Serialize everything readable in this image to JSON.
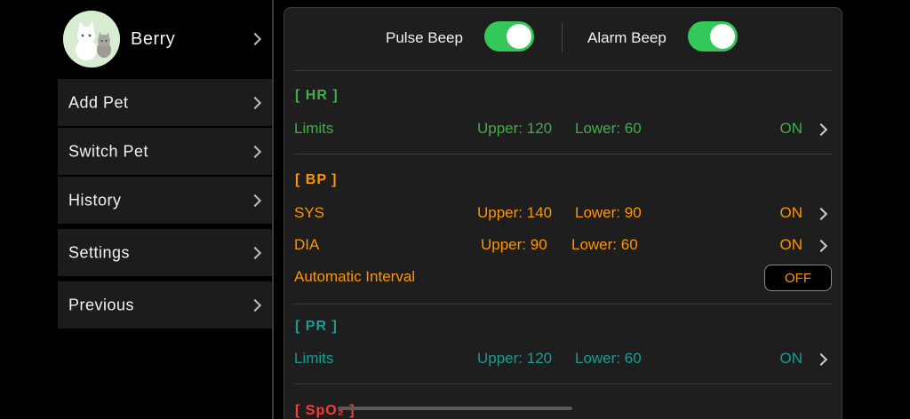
{
  "profile": {
    "name": "Berry"
  },
  "menu": {
    "add_pet": "Add Pet",
    "switch_pet": "Switch Pet",
    "history": "History",
    "settings": "Settings",
    "previous": "Previous"
  },
  "toggles": {
    "pulse_beep": {
      "label": "Pulse Beep",
      "on": true
    },
    "alarm_beep": {
      "label": "Alarm Beep",
      "on": true
    }
  },
  "hr": {
    "title": "[ HR ]",
    "limits": {
      "name": "Limits",
      "upper": "Upper: 120",
      "lower": "Lower: 60",
      "state": "ON"
    }
  },
  "bp": {
    "title": "[ BP ]",
    "sys": {
      "name": "SYS",
      "upper": "Upper: 140",
      "lower": "Lower: 90",
      "state": "ON"
    },
    "dia": {
      "name": "DIA",
      "upper": "Upper: 90",
      "lower": "Lower: 60",
      "state": "ON"
    },
    "auto": {
      "name": "Automatic Interval",
      "button": "OFF"
    }
  },
  "pr": {
    "title": "[ PR ]",
    "limits": {
      "name": "Limits",
      "upper": "Upper: 120",
      "lower": "Lower: 60",
      "state": "ON"
    }
  },
  "spo2": {
    "title": "[ SpO₂ ]"
  },
  "colors": {
    "hr": "#3fae49",
    "bp": "#ff9500",
    "pr": "#1a9c92",
    "spo2": "#ff3b30",
    "switch_on": "#34c759"
  }
}
